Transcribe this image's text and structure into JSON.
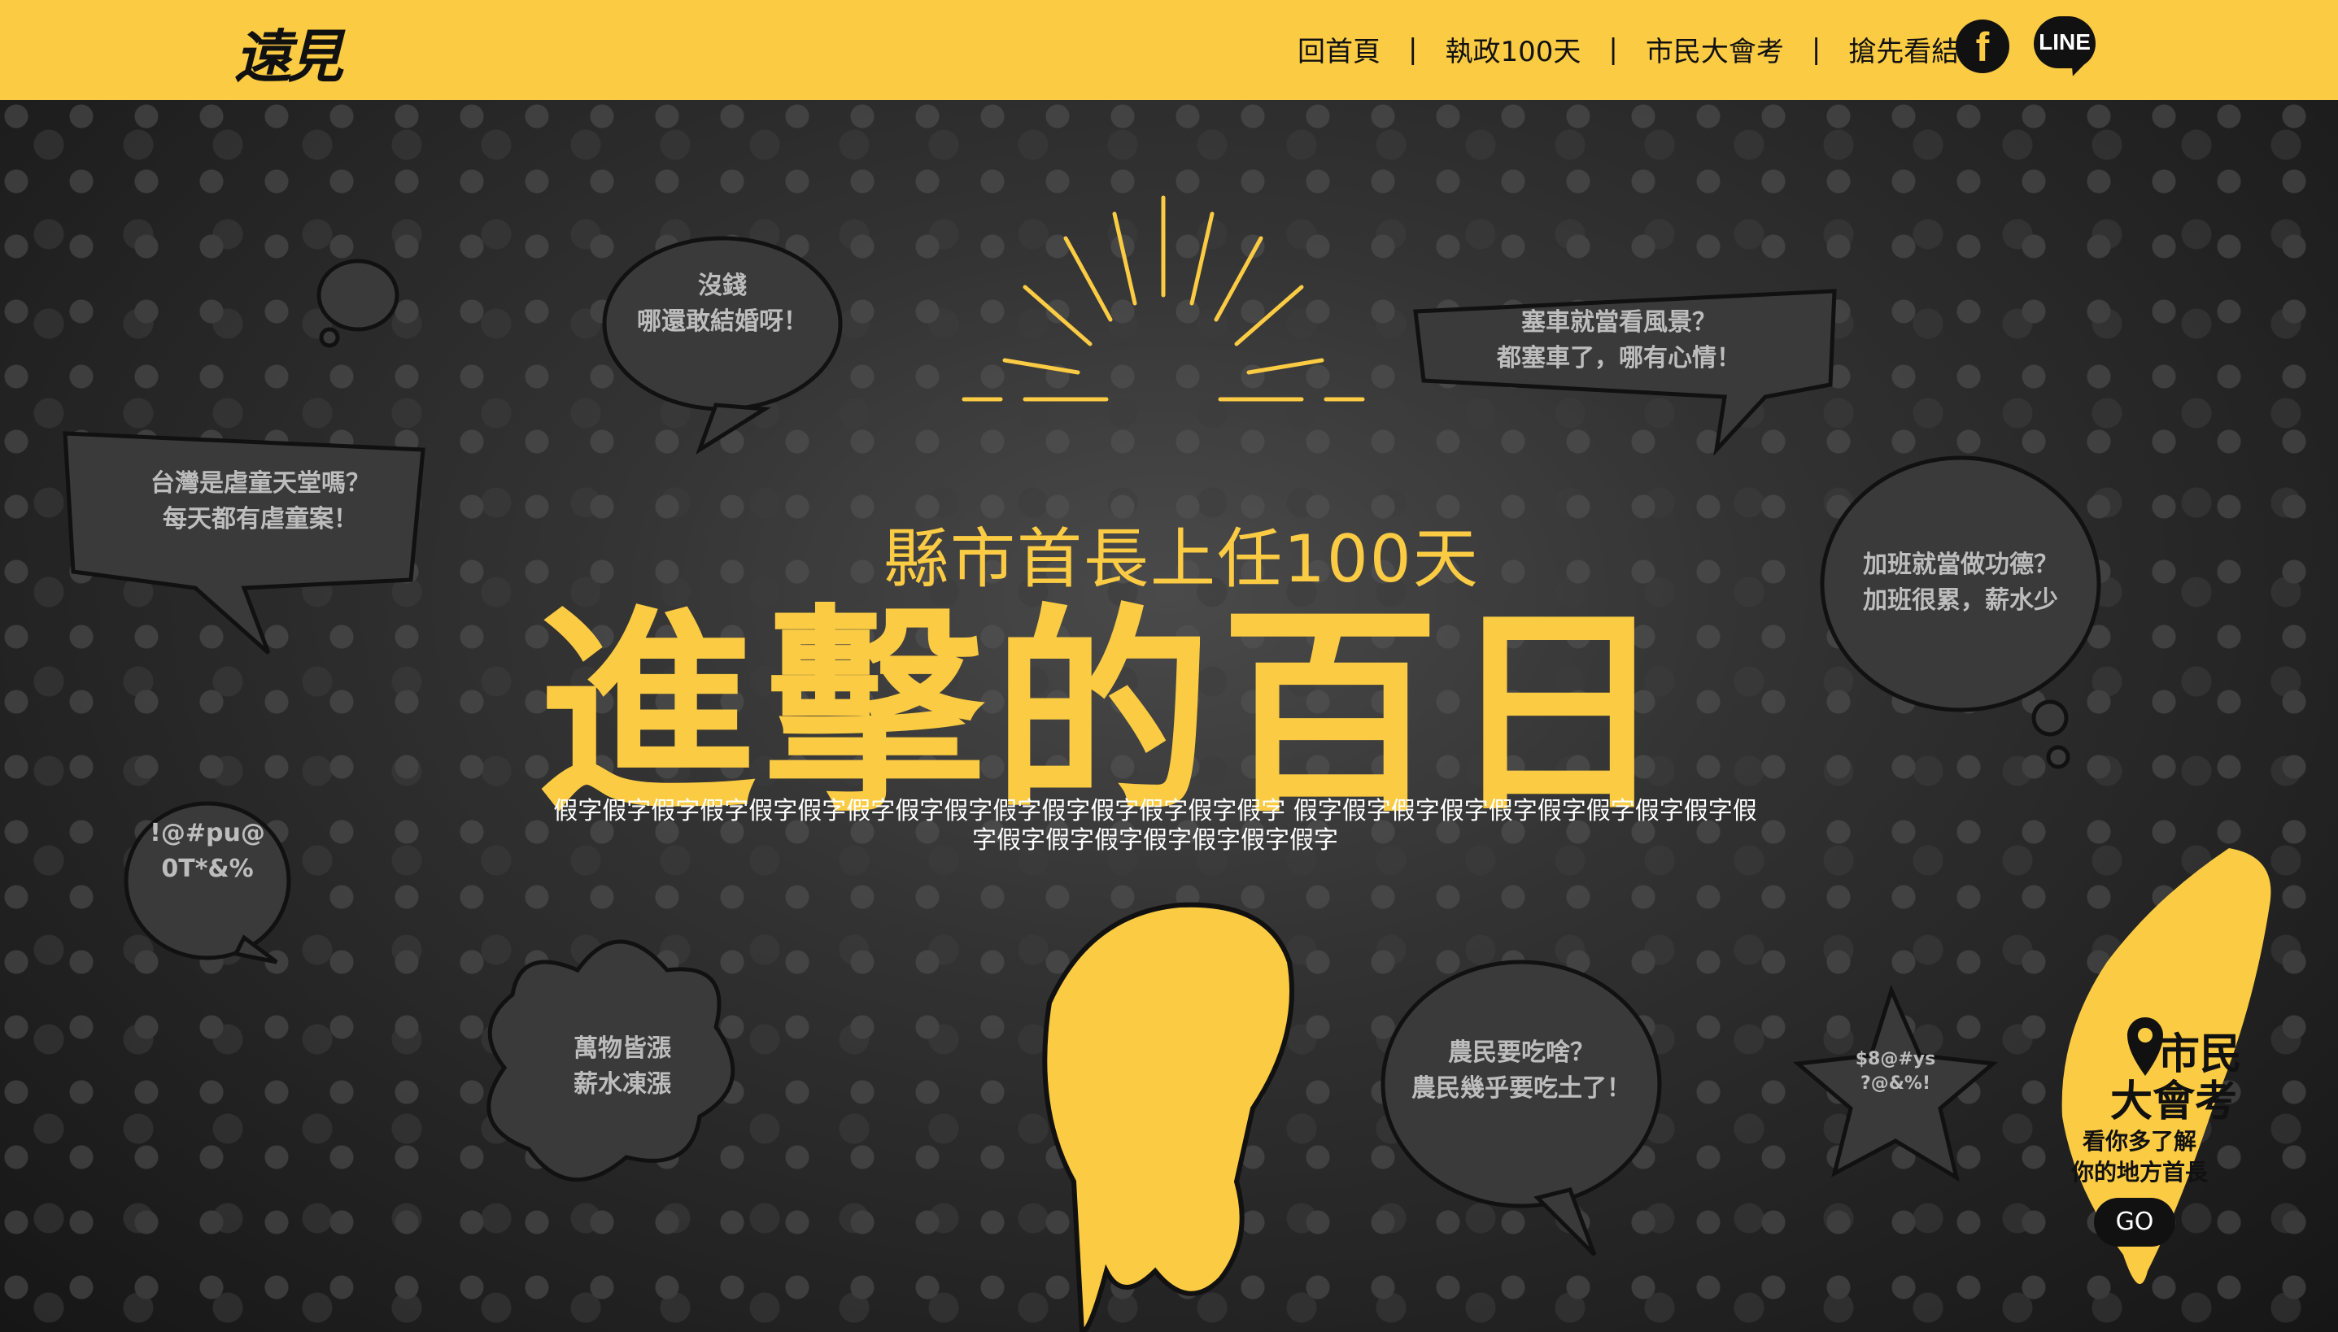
{
  "brand": {
    "logo": "遠見"
  },
  "nav": [
    {
      "label": "回首頁"
    },
    {
      "label": "執政100天"
    },
    {
      "label": "市民大會考"
    },
    {
      "label": "搶先看結果"
    }
  ],
  "social": {
    "facebook_icon": "f",
    "line_icon": "LINE"
  },
  "hero": {
    "headline": "縣市首長上任100天",
    "title": "進擊的百日",
    "subtitle_line1": "假字假字假字假字假字假字假字假字假字假字假字假字假字假字假字 假字假字假字假字假字假字假字假字假字假",
    "subtitle_line2": "字假字假字假字假字假字假字假字"
  },
  "bubbles": [
    {
      "text": "沒錢\n哪還敢結婚呀！"
    },
    {
      "text": "塞車就當看風景？\n都塞車了，哪有心情！"
    },
    {
      "text": "台灣是虐童天堂嗎？\n每天都有虐童案！"
    },
    {
      "text": "加班就當做功德？\n加班很累，薪水少"
    },
    {
      "text": "!@#pu@\n0T*&%"
    },
    {
      "text": "萬物皆漲\n薪水凍漲"
    },
    {
      "text": "農民要吃啥？\n農民幾乎要吃土了！"
    },
    {
      "text": "$8@#ys\n?@&%!"
    }
  ],
  "exam_widget": {
    "title_line1": "市民",
    "title_line2": "大會考",
    "sub_line1": "看你多了解",
    "sub_line2": "你的地方首長",
    "button": "GO"
  },
  "colors": {
    "accent": "#fbcb43",
    "dark": "#111111"
  }
}
